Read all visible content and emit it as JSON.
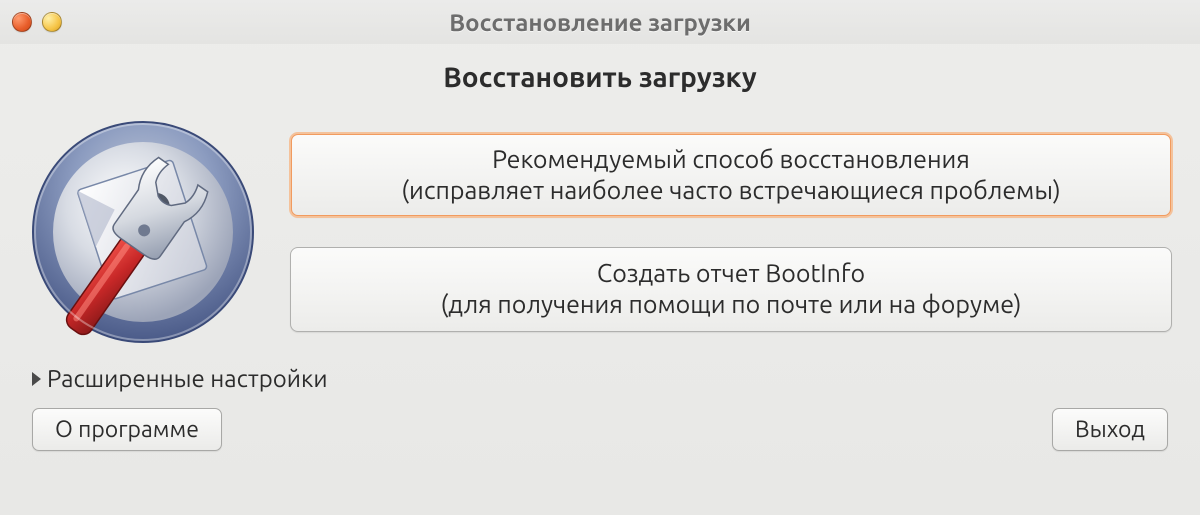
{
  "window": {
    "title": "Восстановление загрузки"
  },
  "content": {
    "heading": "Восстановить загрузку",
    "options": {
      "recommended": {
        "title": "Рекомендуемый способ восстановления",
        "subtitle": "(исправляет наиболее часто встречающиеся проблемы)"
      },
      "bootinfo": {
        "title": "Создать отчет BootInfo",
        "subtitle": "(для получения помощи по почте или на форуме)"
      }
    },
    "expander_label": "Расширенные настройки"
  },
  "footer": {
    "about_label": "О программе",
    "exit_label": "Выход"
  }
}
